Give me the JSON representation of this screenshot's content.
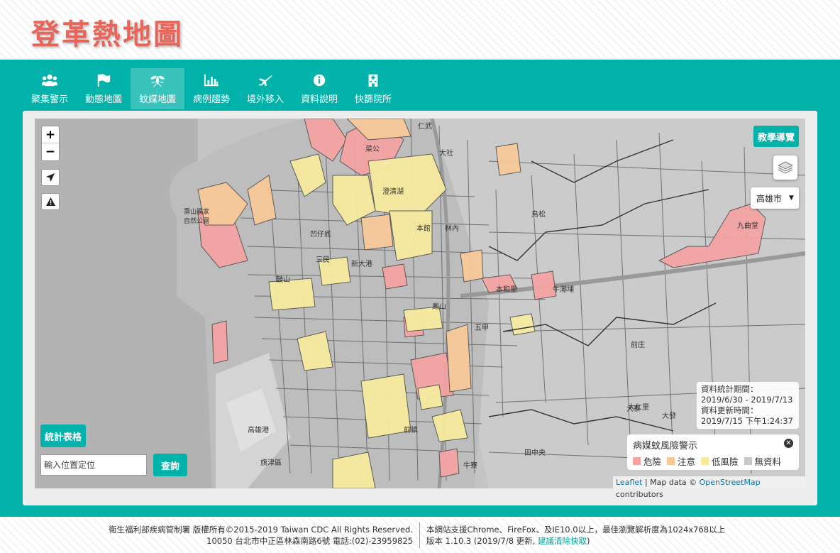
{
  "site": {
    "title": "登革熱地圖"
  },
  "nav": [
    {
      "label": "聚集警示",
      "icon": "users-icon"
    },
    {
      "label": "動態地圖",
      "icon": "flag-icon"
    },
    {
      "label": "蚊媒地圖",
      "icon": "mosquito-icon",
      "active": true
    },
    {
      "label": "病例趨勢",
      "icon": "bar-chart-icon"
    },
    {
      "label": "境外移入",
      "icon": "plane-icon"
    },
    {
      "label": "資料說明",
      "icon": "info-icon"
    },
    {
      "label": "快篩院所",
      "icon": "hospital-icon"
    }
  ],
  "map": {
    "zoom_in": "+",
    "zoom_out": "−",
    "tutorial_button": "教學導覽",
    "city_select": "高雄市",
    "stats_button": "統計表格",
    "search_placeholder": "輸入位置定位",
    "search_button": "查詢",
    "date_info": {
      "period_label": "資料統計期間：",
      "period_value": "2019/6/30 - 2019/7/13",
      "update_label": "資料更新時間：",
      "update_value": "2019/7/15 下午1:24:37"
    },
    "legend": {
      "title": "病媒蚊風險警示",
      "close": "✕",
      "items": [
        {
          "label": "危險",
          "color": "#f4a3a3"
        },
        {
          "label": "注意",
          "color": "#f7c99a"
        },
        {
          "label": "低風險",
          "color": "#f7eba0"
        },
        {
          "label": "無資料",
          "color": "#c8c8c8"
        }
      ]
    },
    "attribution": {
      "leaflet": "Leaflet",
      "sep": " | Map data © ",
      "osm": "OpenStreetMap",
      "suffix": " contributors"
    },
    "place_labels": [
      "菜公",
      "仁武",
      "大社",
      "澄清湖",
      "本館",
      "林內",
      "凹仔底",
      "壽山國家自然公園",
      "三民",
      "鼓山",
      "新大港",
      "鳳山",
      "五甲",
      "前鎮",
      "高雄港",
      "旗津區",
      "大仁里",
      "前庄",
      "牛潮埔",
      "大寮",
      "大發",
      "田中央",
      "牛寮",
      "九曲堂",
      "鳥松",
      "本和里"
    ]
  },
  "footer": {
    "left_line1": "衛生福利部疾病管制署 版權所有©2015-2019 Taiwan CDC All Rights Reserved.",
    "left_line2": "10050 台北市中正區林森南路6號 電話:(02)-23959825",
    "right_line1": "本網站支援Chrome、FireFox、及IE10.0以上，最佳瀏覽解析度為1024x768以上",
    "right_line2_prefix": "版本 1.10.3 (2019/7/8 更新, ",
    "right_line2_link": "建議清除快取",
    "right_line2_suffix": ")"
  }
}
